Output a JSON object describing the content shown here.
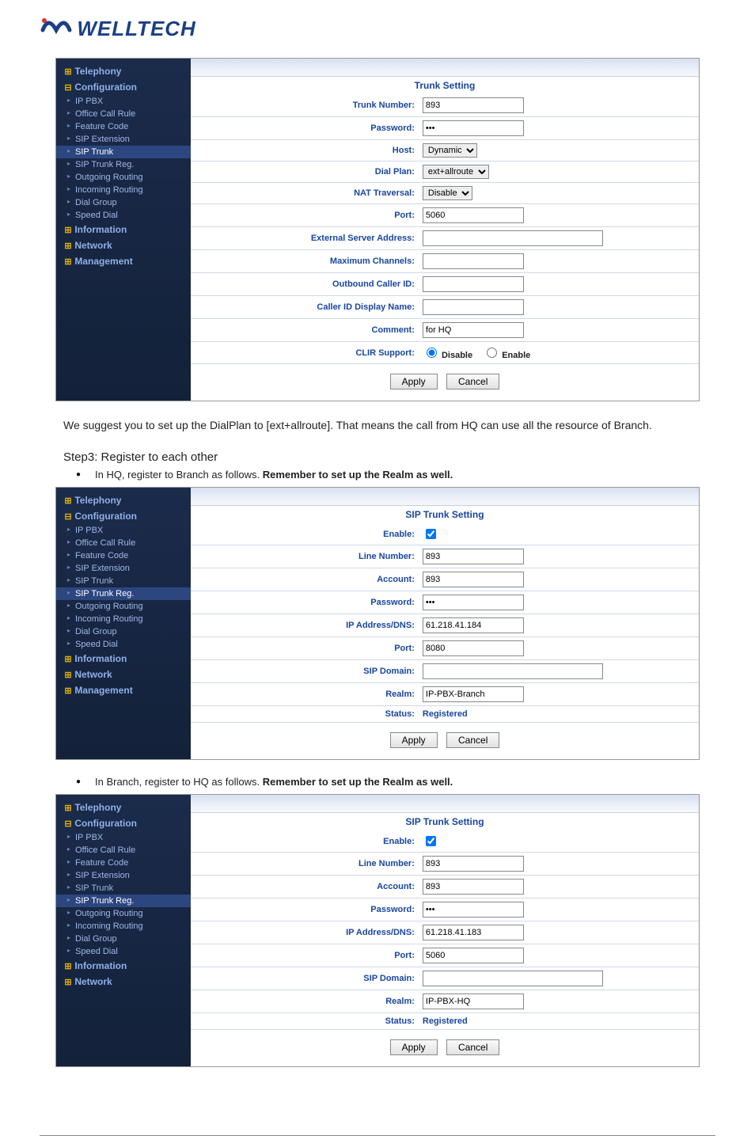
{
  "body": {
    "logo_text": "WELLTECH",
    "para1": "We suggest you to set up the DialPlan to [ext+allroute]. That means the call from HQ can use all the resource of Branch.",
    "step3_heading": "Step3: Register to each other",
    "bullet_hq_prefix": "In HQ, register to Branch as follows. ",
    "bullet_hq_bold": "Remember to set up the Realm as well.",
    "bullet_branch_prefix": "In Branch, register to HQ as follows. ",
    "bullet_branch_bold": "Remember to set up the Realm as well."
  },
  "sidebar": {
    "telephony": "Telephony",
    "configuration": "Configuration",
    "ip_pbx": "IP PBX",
    "office_call_rule": "Office Call Rule",
    "feature_code": "Feature Code",
    "sip_extension": "SIP Extension",
    "sip_trunk": "SIP Trunk",
    "sip_trunk_reg": "SIP Trunk Reg.",
    "outgoing_routing": "Outgoing Routing",
    "incoming_routing": "Incoming Routing",
    "dial_group": "Dial Group",
    "speed_dial": "Speed Dial",
    "information": "Information",
    "network": "Network",
    "management": "Management"
  },
  "panel1": {
    "title": "Trunk Setting",
    "labels": {
      "trunk_number": "Trunk Number:",
      "password": "Password:",
      "host": "Host:",
      "dial_plan": "Dial Plan:",
      "nat_traversal": "NAT Traversal:",
      "port": "Port:",
      "external_server_address": "External Server Address:",
      "maximum_channels": "Maximum Channels:",
      "outbound_caller_id": "Outbound Caller ID:",
      "caller_id_display_name": "Caller ID Display Name:",
      "comment": "Comment:",
      "clir_support": "CLIR Support:"
    },
    "values": {
      "trunk_number": "893",
      "password": "•••",
      "host": "Dynamic",
      "dial_plan": "ext+allroute",
      "nat_traversal": "Disable",
      "port": "5060",
      "external_server_address": "",
      "maximum_channels": "",
      "outbound_caller_id": "",
      "caller_id_display_name": "",
      "comment": "for HQ",
      "clir_disable": "Disable",
      "clir_enable": "Enable"
    },
    "buttons": {
      "apply": "Apply",
      "cancel": "Cancel"
    }
  },
  "panel2": {
    "title": "SIP Trunk Setting",
    "labels": {
      "enable": "Enable:",
      "line_number": "Line Number:",
      "account": "Account:",
      "password": "Password:",
      "ip_address_dns": "IP Address/DNS:",
      "port": "Port:",
      "sip_domain": "SIP Domain:",
      "realm": "Realm:",
      "status": "Status:"
    },
    "values": {
      "line_number": "893",
      "account": "893",
      "password": "•••",
      "ip_address_dns": "61.218.41.184",
      "port": "8080",
      "sip_domain": "",
      "realm": "IP-PBX-Branch",
      "status": "Registered"
    },
    "buttons": {
      "apply": "Apply",
      "cancel": "Cancel"
    }
  },
  "panel3": {
    "title": "SIP Trunk Setting",
    "labels": {
      "enable": "Enable:",
      "line_number": "Line Number:",
      "account": "Account:",
      "password": "Password:",
      "ip_address_dns": "IP Address/DNS:",
      "port": "Port:",
      "sip_domain": "SIP Domain:",
      "realm": "Realm:",
      "status": "Status:"
    },
    "values": {
      "line_number": "893",
      "account": "893",
      "password": "•••",
      "ip_address_dns": "61.218.41.183",
      "port": "5060",
      "sip_domain": "",
      "realm": "IP-PBX-HQ",
      "status": "Registered"
    },
    "buttons": {
      "apply": "Apply",
      "cancel": "Cancel"
    }
  }
}
